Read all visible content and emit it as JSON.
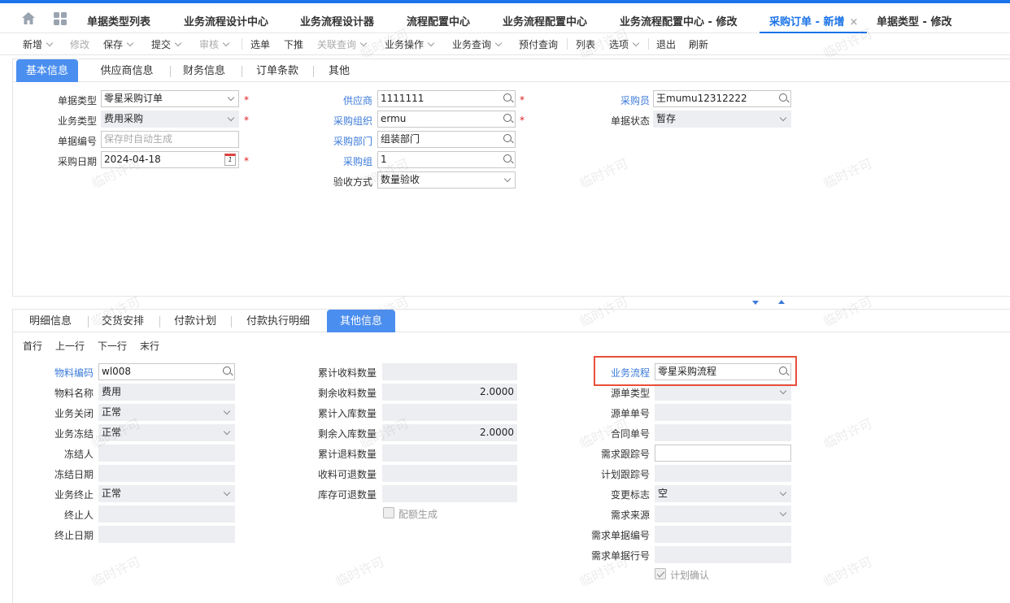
{
  "top_tabs": [
    {
      "label": "单据类型列表"
    },
    {
      "label": "业务流程设计中心"
    },
    {
      "label": "业务流程设计器"
    },
    {
      "label": "流程配置中心"
    },
    {
      "label": "业务流程配置中心"
    },
    {
      "label": "业务流程配置中心 - 修改"
    },
    {
      "label": "采购订单 - 新增",
      "active": true,
      "close": "×"
    },
    {
      "label": "单据类型 - 修改"
    }
  ],
  "toolbar": {
    "new": "新增",
    "edit": "修改",
    "save": "保存",
    "submit": "提交",
    "audit": "审核",
    "select": "选单",
    "push": "下推",
    "related_query": "关联查询",
    "biz_ops": "业务操作",
    "biz_query": "业务查询",
    "prepay_query": "预付查询",
    "list": "列表",
    "options": "选项",
    "exit": "退出",
    "refresh": "刷新"
  },
  "header_tabs": [
    "基本信息",
    "供应商信息",
    "财务信息",
    "订单条款",
    "其他"
  ],
  "header_form": {
    "bill_type": {
      "label": "单据类型",
      "value": "零星采购订单"
    },
    "biz_type": {
      "label": "业务类型",
      "value": "费用采购"
    },
    "bill_no": {
      "label": "单据编号",
      "placeholder": "保存时自动生成"
    },
    "purchase_date": {
      "label": "采购日期",
      "value": "2024-04-18",
      "cal": "1"
    },
    "supplier": {
      "label": "供应商",
      "value": "1111111"
    },
    "purchase_org": {
      "label": "采购组织",
      "value": "ermu"
    },
    "purchase_dept": {
      "label": "采购部门",
      "value": "组装部门"
    },
    "purchase_group": {
      "label": "采购组",
      "value": "1"
    },
    "acceptance": {
      "label": "验收方式",
      "value": "数量验收"
    },
    "buyer": {
      "label": "采购员",
      "value": "王mumu12312222"
    },
    "bill_status": {
      "label": "单据状态",
      "value": "暂存"
    },
    "required_mark": "*"
  },
  "detail_tabs": [
    "明细信息",
    "交货安排",
    "付款计划",
    "付款执行明细",
    "其他信息"
  ],
  "row_nav": {
    "first": "首行",
    "prev": "上一行",
    "next": "下一行",
    "last": "末行"
  },
  "detail_col1": [
    {
      "label": "物料编码",
      "value": "wl008",
      "type": "lookup",
      "blue": true
    },
    {
      "label": "物料名称",
      "value": "费用",
      "type": "ro"
    },
    {
      "label": "业务关闭",
      "value": "正常",
      "type": "select-ro"
    },
    {
      "label": "业务冻结",
      "value": "正常",
      "type": "select-ro"
    },
    {
      "label": "冻结人",
      "value": "",
      "type": "ro"
    },
    {
      "label": "冻结日期",
      "value": "",
      "type": "ro"
    },
    {
      "label": "业务终止",
      "value": "正常",
      "type": "select-ro"
    },
    {
      "label": "终止人",
      "value": "",
      "type": "ro"
    },
    {
      "label": "终止日期",
      "value": "",
      "type": "ro"
    }
  ],
  "detail_col2": [
    {
      "label": "累计收料数量",
      "value": ""
    },
    {
      "label": "剩余收料数量",
      "value": "2.0000"
    },
    {
      "label": "累计入库数量",
      "value": ""
    },
    {
      "label": "剩余入库数量",
      "value": "2.0000"
    },
    {
      "label": "累计退料数量",
      "value": ""
    },
    {
      "label": "收料可退数量",
      "value": ""
    },
    {
      "label": "库存可退数量",
      "value": ""
    }
  ],
  "quota_generate": "配额生成",
  "detail_col3": [
    {
      "label": "业务流程",
      "value": "零星采购流程",
      "type": "lookup",
      "blue": true
    },
    {
      "label": "源单类型",
      "value": "",
      "type": "select-ro"
    },
    {
      "label": "源单单号",
      "value": "",
      "type": "ro"
    },
    {
      "label": "合同单号",
      "value": "",
      "type": "ro"
    },
    {
      "label": "需求跟踪号",
      "value": "",
      "type": "input"
    },
    {
      "label": "计划跟踪号",
      "value": "",
      "type": "ro"
    },
    {
      "label": "变更标志",
      "value": "空",
      "type": "select-ro"
    },
    {
      "label": "需求来源",
      "value": "",
      "type": "select-ro"
    },
    {
      "label": "需求单据编号",
      "value": "",
      "type": "ro"
    },
    {
      "label": "需求单据行号",
      "value": "",
      "type": "ro"
    }
  ],
  "plan_confirm": "计划确认",
  "watermark": "临时许可",
  "colors": {
    "accent": "#1a73e8",
    "tab_active_bg": "#4a8ef0",
    "label_link": "#3b7ad9",
    "required": "#e02020",
    "highlight": "#e8503a"
  }
}
